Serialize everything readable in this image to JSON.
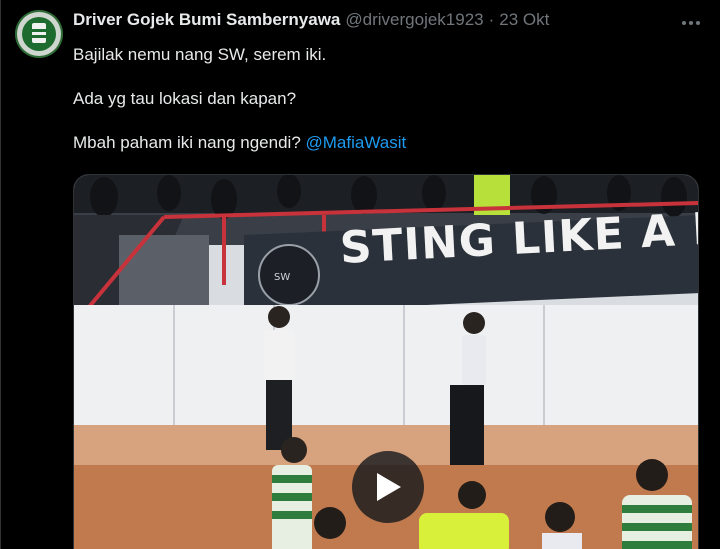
{
  "author": {
    "display_name": "Driver Gojek Bumi Sambernyawa",
    "handle": "@drivergojek1923",
    "separator": "·",
    "date": "23 Okt",
    "avatar_icon": "avatar-logo-icon"
  },
  "tweet": {
    "line1": "Bajilak nemu nang SW, serem iki.",
    "line2": "Ada yg tau lokasi dan kapan?",
    "line3_text": "Mbah paham iki nang ngendi? ",
    "line3_mention": "@MafiaWasit"
  },
  "media": {
    "type": "video",
    "banner_text": "STING LIKE A BE",
    "play_icon": "play-icon"
  },
  "menu": {
    "more_icon": "more-options-icon"
  },
  "colors": {
    "background": "#000000",
    "text": "#e7e9ea",
    "muted": "#71767b",
    "link": "#1d9bf0",
    "banner": "#2b313a"
  }
}
